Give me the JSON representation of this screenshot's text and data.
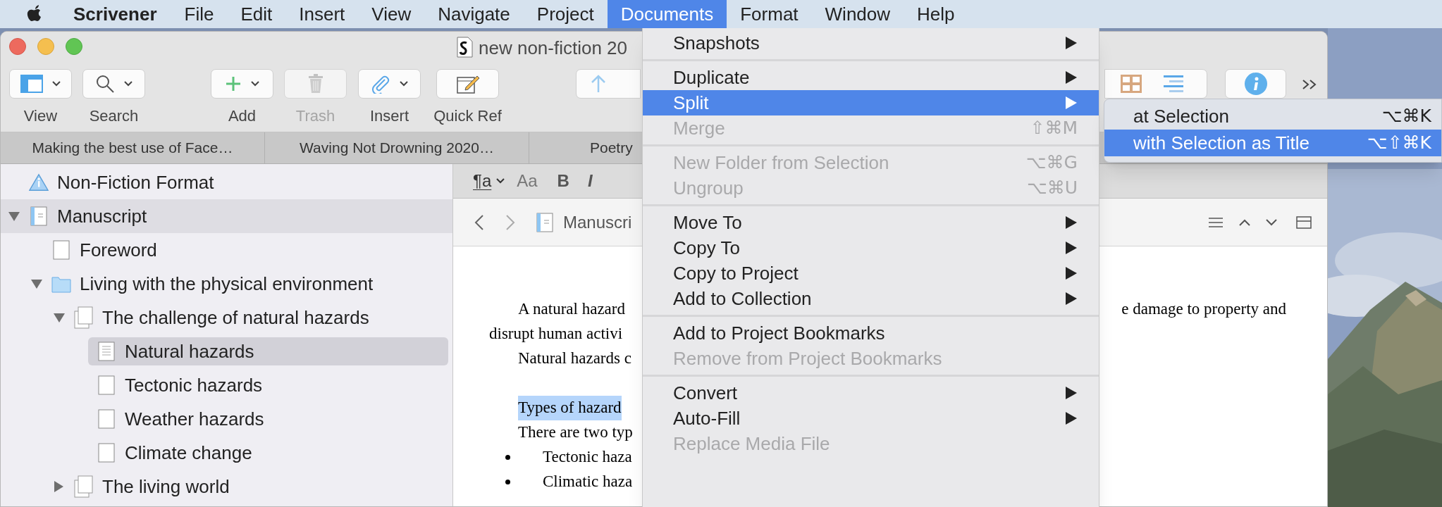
{
  "menu_bar": {
    "app": "Scrivener",
    "items": [
      {
        "label": "File",
        "selected": false
      },
      {
        "label": "Edit",
        "selected": false
      },
      {
        "label": "Insert",
        "selected": false
      },
      {
        "label": "View",
        "selected": false
      },
      {
        "label": "Navigate",
        "selected": false
      },
      {
        "label": "Project",
        "selected": false
      },
      {
        "label": "Documents",
        "selected": true
      },
      {
        "label": "Format",
        "selected": false
      },
      {
        "label": "Window",
        "selected": false
      },
      {
        "label": "Help",
        "selected": false
      }
    ]
  },
  "window": {
    "title": "new non-fiction 20"
  },
  "toolbar": {
    "items": [
      {
        "kind": "view",
        "label": "View",
        "disabled": false
      },
      {
        "kind": "search",
        "label": "Search",
        "disabled": false
      },
      {
        "kind": "add",
        "label": "Add",
        "disabled": false
      },
      {
        "kind": "trash",
        "label": "Trash",
        "disabled": true
      },
      {
        "kind": "insert",
        "label": "Insert",
        "disabled": false
      },
      {
        "kind": "quick_ref",
        "label": "Quick Ref",
        "disabled": false
      }
    ]
  },
  "tabs": [
    "Making the best use of Face…",
    "Waving Not Drowning 2020…",
    "Poetry"
  ],
  "binder": {
    "items": [
      {
        "label": "Non-Fiction Format",
        "kind": "info",
        "selected": false
      },
      {
        "label": "Manuscript",
        "kind": "draft",
        "expanded": true,
        "selected": false,
        "children": [
          {
            "label": "Foreword",
            "kind": "page",
            "selected": false
          },
          {
            "label": "Living with the physical environment",
            "kind": "folder",
            "expanded": true,
            "selected": false,
            "children": [
              {
                "label": "The challenge of natural hazards",
                "kind": "stack",
                "expanded": true,
                "selected": false,
                "children": [
                  {
                    "label": "Natural hazards",
                    "kind": "page_text",
                    "selected": true
                  },
                  {
                    "label": "Tectonic hazards",
                    "kind": "page",
                    "selected": false
                  },
                  {
                    "label": "Weather hazards",
                    "kind": "page",
                    "selected": false
                  },
                  {
                    "label": "Climate change",
                    "kind": "page",
                    "selected": false
                  }
                ]
              },
              {
                "label": "The living world",
                "kind": "stack",
                "expanded": false,
                "selected": false
              }
            ]
          }
        ]
      }
    ]
  },
  "format_bar": {
    "paragraph_style": "¶a",
    "fonts": "Aa",
    "bold": "B",
    "italic": "I"
  },
  "navigation": {
    "path": "Manuscri"
  },
  "document": {
    "lines": [
      {
        "kind": "first",
        "text": "A natural hazard",
        "tail": "e damage to property and"
      },
      {
        "kind": "body",
        "text": "disrupt human activi"
      },
      {
        "kind": "first",
        "text": "Natural hazards c"
      },
      {
        "kind": "blank"
      },
      {
        "kind": "first",
        "text": "Types of hazard",
        "highlighted": true
      },
      {
        "kind": "first",
        "text": "There are two typ"
      },
      {
        "kind": "bullet",
        "text": "Tectonic haza"
      },
      {
        "kind": "bullet",
        "text": "Climatic haza"
      }
    ]
  },
  "documents_menu": {
    "sections": [
      [
        {
          "label": "Snapshots",
          "has_submenu": true,
          "disabled": false,
          "selected": false
        }
      ],
      [
        {
          "label": "Duplicate",
          "has_submenu": true,
          "disabled": false,
          "selected": false
        },
        {
          "label": "Split",
          "has_submenu": true,
          "disabled": false,
          "selected": true
        },
        {
          "label": "Merge",
          "shortcut": "⇧⌘M",
          "has_submenu": false,
          "disabled": true,
          "selected": false
        }
      ],
      [
        {
          "label": "New Folder from Selection",
          "shortcut": "⌥⌘G",
          "has_submenu": false,
          "disabled": true,
          "selected": false
        },
        {
          "label": "Ungroup",
          "shortcut": "⌥⌘U",
          "has_submenu": false,
          "disabled": true,
          "selected": false
        }
      ],
      [
        {
          "label": "Move To",
          "has_submenu": true,
          "disabled": false,
          "selected": false
        },
        {
          "label": "Copy To",
          "has_submenu": true,
          "disabled": false,
          "selected": false
        },
        {
          "label": "Copy to Project",
          "has_submenu": true,
          "disabled": false,
          "selected": false
        },
        {
          "label": "Add to Collection",
          "has_submenu": true,
          "disabled": false,
          "selected": false
        }
      ],
      [
        {
          "label": "Add to Project Bookmarks",
          "has_submenu": false,
          "disabled": false,
          "selected": false
        },
        {
          "label": "Remove from Project Bookmarks",
          "has_submenu": false,
          "disabled": true,
          "selected": false
        }
      ],
      [
        {
          "label": "Convert",
          "has_submenu": true,
          "disabled": false,
          "selected": false
        },
        {
          "label": "Auto-Fill",
          "has_submenu": true,
          "disabled": false,
          "selected": false
        },
        {
          "label": "Replace Media File",
          "has_submenu": false,
          "disabled": true,
          "selected": false
        }
      ]
    ]
  },
  "split_submenu": {
    "items": [
      {
        "label": "at Selection",
        "shortcut": "⌥⌘K",
        "selected": false
      },
      {
        "label": "with Selection as Title",
        "shortcut": "⌥⇧⌘K",
        "selected": true
      }
    ]
  }
}
